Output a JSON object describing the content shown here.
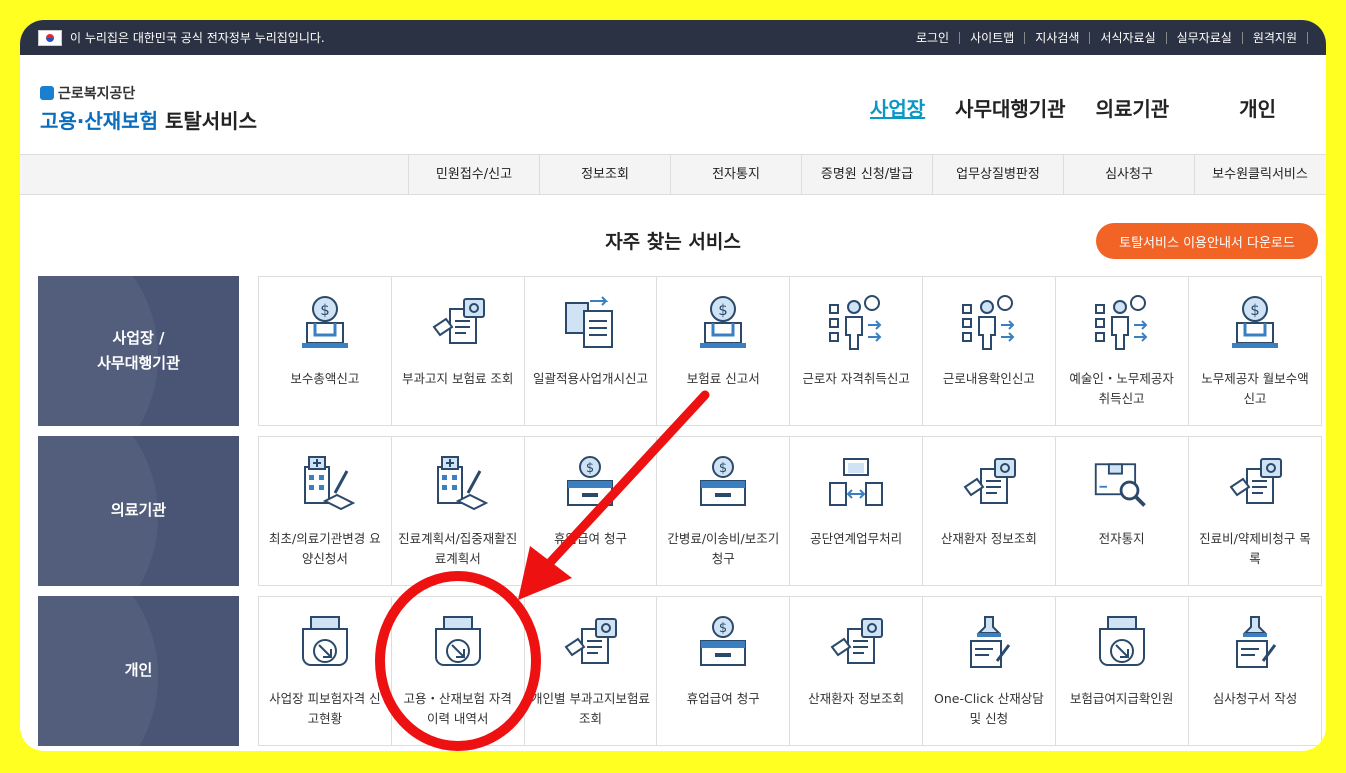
{
  "topbar": {
    "notice": "이 누리집은 대한민국 공식 전자정부 누리집입니다.",
    "links": [
      "로그인",
      "사이트맵",
      "지사검색",
      "서식자료실",
      "실무자료실",
      "원격지원"
    ]
  },
  "logo": {
    "org": "근로복지공단",
    "service_blue": "고용·산재보험",
    "service_dark": "토탈서비스"
  },
  "main_nav": [
    "사업장",
    "사무대행기관",
    "의료기관",
    "개인"
  ],
  "sub_nav": [
    "민원접수/신고",
    "정보조회",
    "전자통지",
    "증명원 신청/발급",
    "업무상질병판정",
    "심사청구",
    "보수원클릭서비스"
  ],
  "section": {
    "title": "자주 찾는 서비스",
    "guide_button": "토탈서비스 이용안내서 다운로드"
  },
  "rows": [
    {
      "category": "사업장 /\n사무대행기관",
      "tiles": [
        {
          "label": "보수총액신고",
          "icon": "money-laptop-icon"
        },
        {
          "label": "부과고지 보험료 조회",
          "icon": "document-search-icon"
        },
        {
          "label": "일괄적용사업개시신고",
          "icon": "documents-transfer-icon"
        },
        {
          "label": "보험료 신고서",
          "icon": "money-laptop-icon"
        },
        {
          "label": "근로자 자격취득신고",
          "icon": "person-checklist-icon"
        },
        {
          "label": "근로내용확인신고",
          "icon": "person-checklist-icon"
        },
        {
          "label": "예술인・노무제공자 취득신고",
          "icon": "person-checklist-icon"
        },
        {
          "label": "노무제공자 월보수액 신고",
          "icon": "money-laptop-icon"
        }
      ]
    },
    {
      "category": "의료기관",
      "tiles": [
        {
          "label": "최초/의료기관변경 요양신청서",
          "icon": "hospital-sign-icon"
        },
        {
          "label": "진료계획서/집중재활진료계획서",
          "icon": "hospital-sign-icon"
        },
        {
          "label": "휴업급여 청구",
          "icon": "money-box-icon"
        },
        {
          "label": "간병료/이송비/보조기 청구",
          "icon": "money-box-icon"
        },
        {
          "label": "공단연계업무처리",
          "icon": "documents-exchange-icon"
        },
        {
          "label": "산재환자 정보조회",
          "icon": "document-search-icon"
        },
        {
          "label": "전자통지",
          "icon": "box-search-icon"
        },
        {
          "label": "진료비/약제비청구 목록",
          "icon": "document-search-icon"
        }
      ]
    },
    {
      "category": "개인",
      "tiles": [
        {
          "label": "사업장 피보험자격 신고현황",
          "icon": "tray-download-icon"
        },
        {
          "label": "고용・산재보험 자격 이력 내역서",
          "icon": "tray-download-icon"
        },
        {
          "label": "개인별 부과고지보험료 조회",
          "icon": "document-search-icon"
        },
        {
          "label": "휴업급여 청구",
          "icon": "money-box-icon"
        },
        {
          "label": "산재환자 정보조회",
          "icon": "document-search-icon"
        },
        {
          "label": "One-Click 산재상담 및 신청",
          "icon": "stamp-document-icon"
        },
        {
          "label": "보험급여지급확인원",
          "icon": "tray-download-icon"
        },
        {
          "label": "심사청구서 작성",
          "icon": "stamp-document-icon"
        }
      ]
    }
  ],
  "colors": {
    "accent": "#0c96c6",
    "orange": "#f26326",
    "category_bg": "#4a5575",
    "icon_blue": "#3a7fc1",
    "annotation_red": "#ee1111",
    "frame_yellow": "#ffff22"
  }
}
